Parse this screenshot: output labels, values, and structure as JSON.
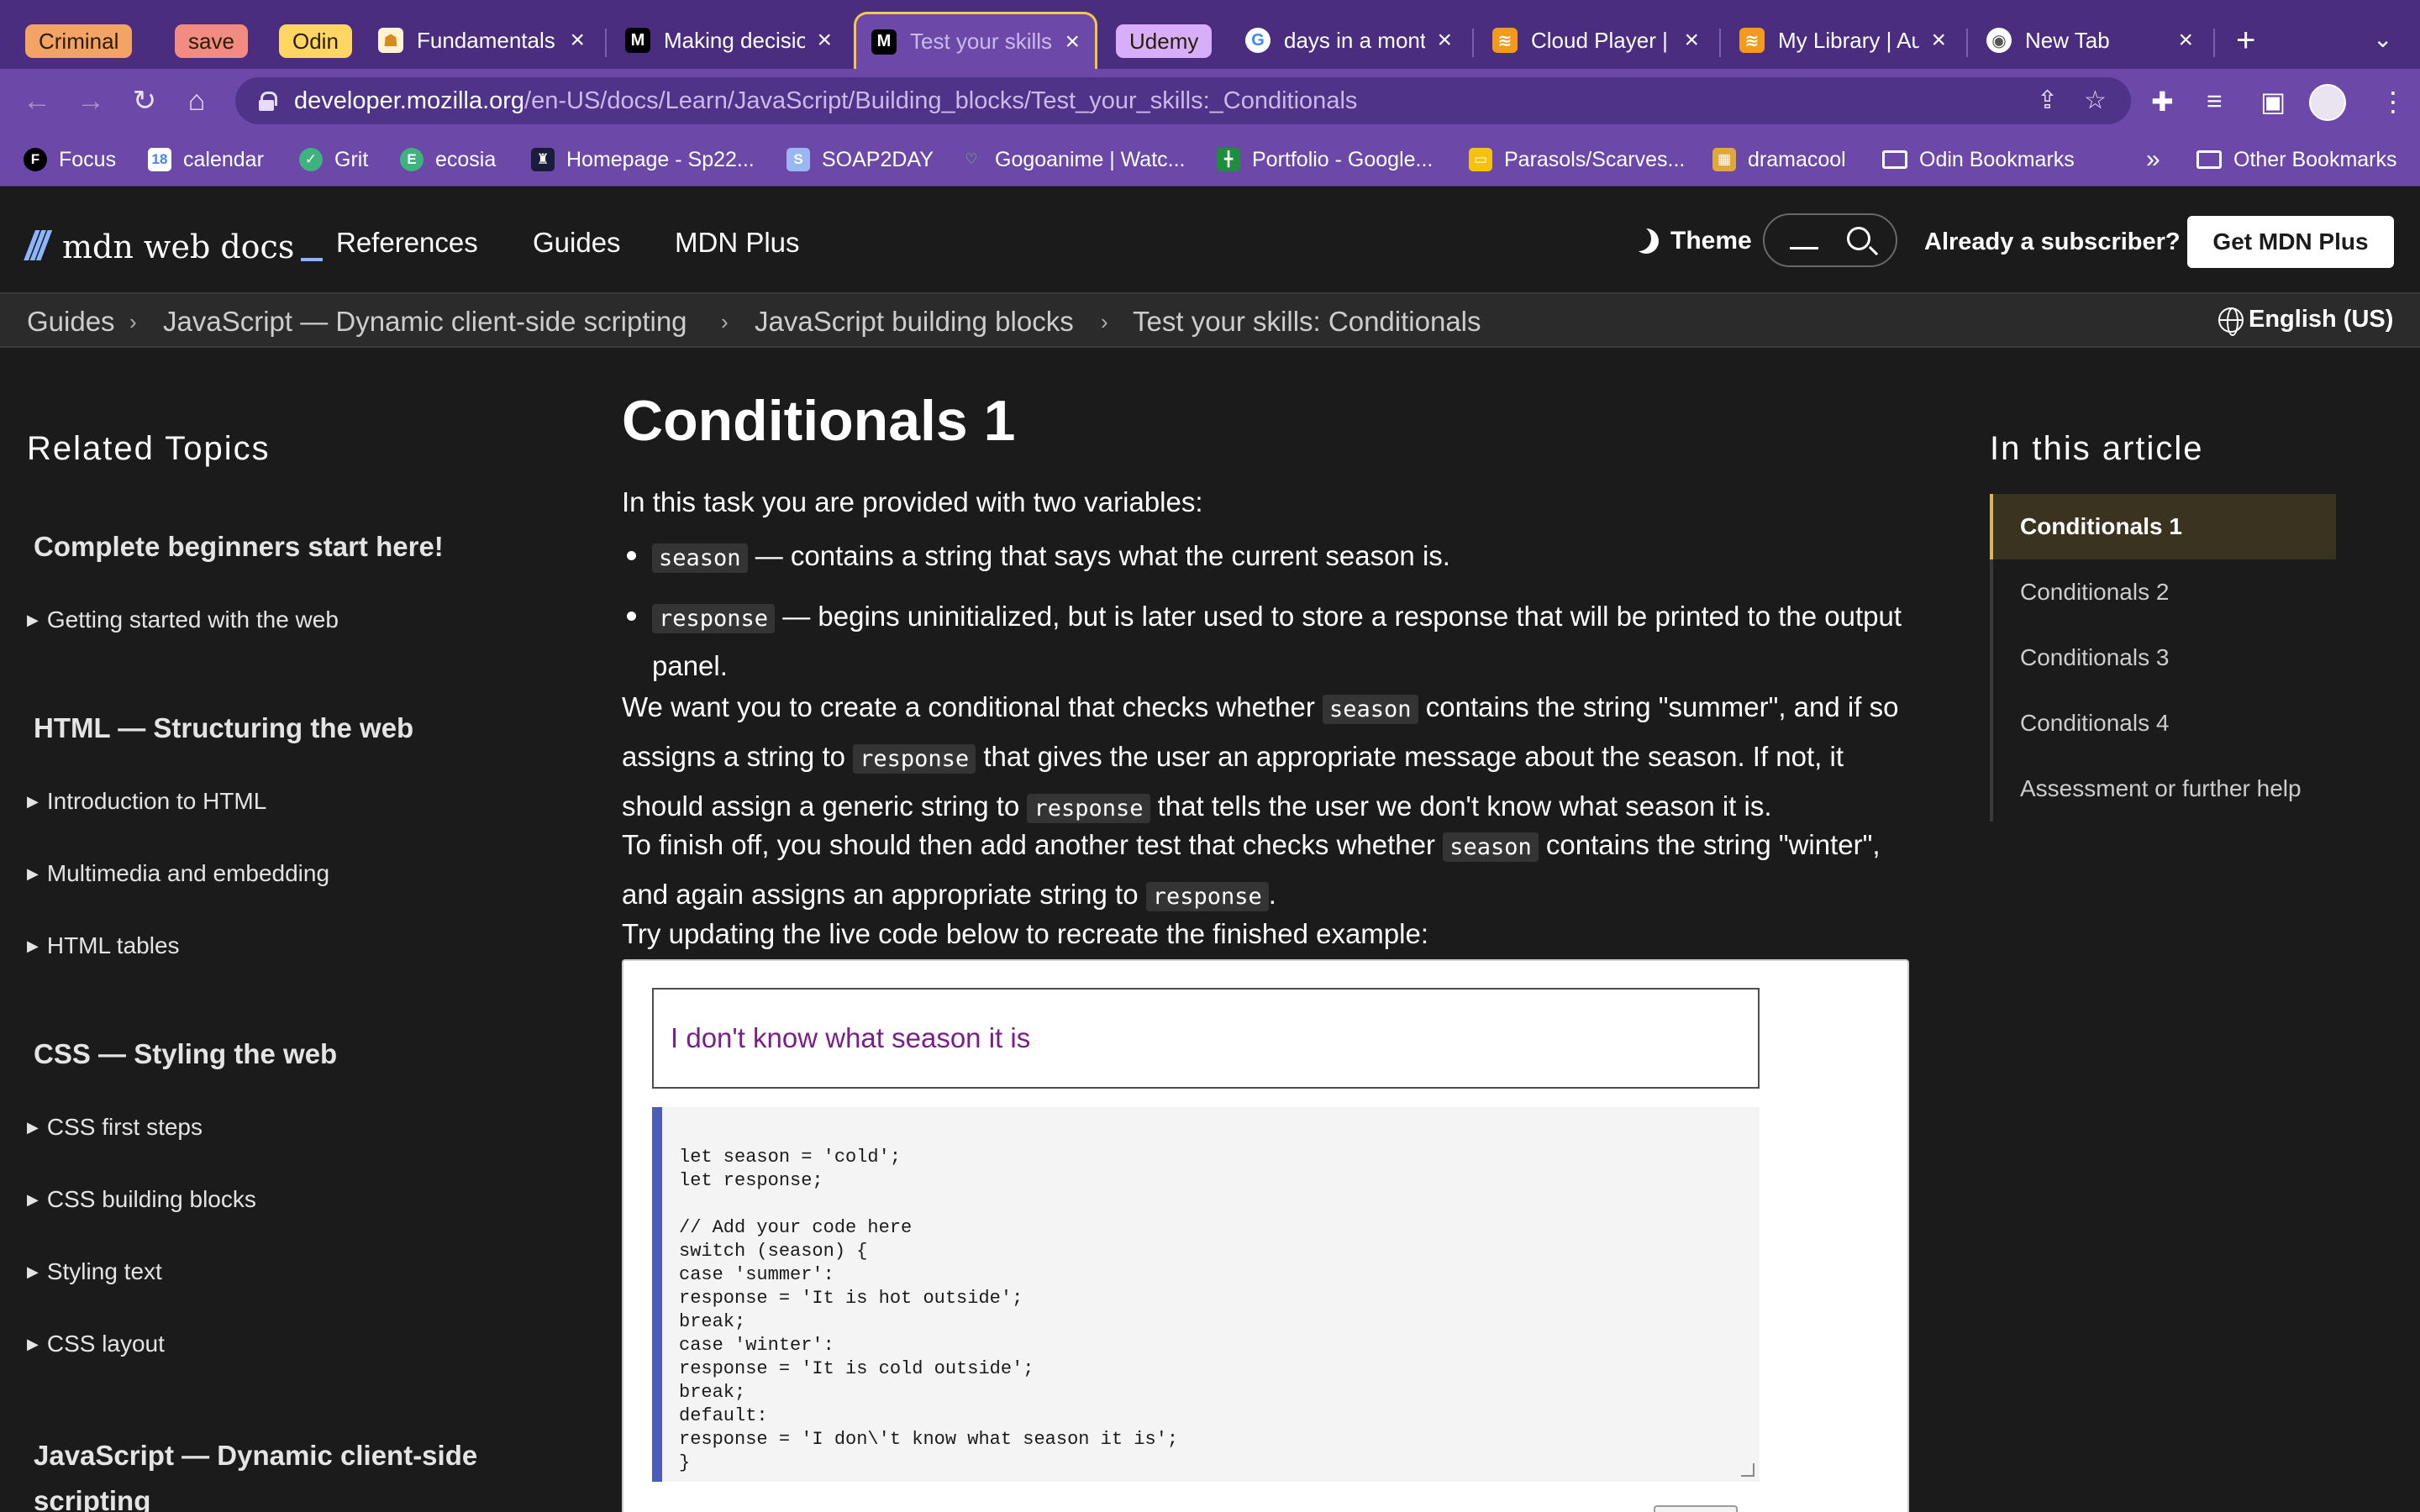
{
  "browser": {
    "tab_groups": [
      {
        "label": "Criminal",
        "color": "#f2a365"
      },
      {
        "label": "save",
        "color": "#f28b82"
      },
      {
        "label": "Odin",
        "color": "#fdd663"
      },
      {
        "label": "Udemy",
        "color": "#d7aefb"
      }
    ],
    "tabs": [
      {
        "title": "Fundamentals",
        "icon": "odin-icon"
      },
      {
        "title": "Making decisio",
        "icon": "mdn-icon"
      },
      {
        "title": "Test your skills",
        "icon": "mdn-icon",
        "active": true
      },
      {
        "title": "days in a mont",
        "icon": "google-icon"
      },
      {
        "title": "Cloud Player | A",
        "icon": "audible-icon"
      },
      {
        "title": "My Library | Au",
        "icon": "audible-icon"
      },
      {
        "title": "New Tab",
        "icon": "chrome-icon"
      }
    ],
    "url": {
      "host": "developer.mozilla.org",
      "path": "/en-US/docs/Learn/JavaScript/Building_blocks/Test_your_skills:_Conditionals"
    },
    "bookmarks": [
      "Focus",
      "calendar",
      "Grit",
      "ecosia",
      "Homepage - Sp22...",
      "SOAP2DAY",
      "Gogoanime | Watc...",
      "Portfolio - Google...",
      "Parasols/Scarves...",
      "dramacool",
      "Odin Bookmarks"
    ],
    "bookmarks_overflow": "»",
    "other_bookmarks": "Other Bookmarks"
  },
  "mdn": {
    "logo_text": "mdn web docs",
    "nav": [
      "References",
      "Guides",
      "MDN Plus"
    ],
    "theme_label": "Theme",
    "subscriber_label": "Already a subscriber?",
    "cta_label": "Get MDN Plus",
    "breadcrumbs": [
      "Guides",
      "JavaScript — Dynamic client-side scripting",
      "JavaScript building blocks",
      "Test your skills: Conditionals"
    ],
    "language": "English (US)"
  },
  "sidebar": {
    "title": "Related Topics",
    "sections": [
      {
        "heading": "Complete beginners start here!",
        "items": [
          "Getting started with the web"
        ]
      },
      {
        "heading": "HTML — Structuring the web",
        "items": [
          "Introduction to HTML",
          "Multimedia and embedding",
          "HTML tables"
        ]
      },
      {
        "heading": "CSS — Styling the web",
        "items": [
          "CSS first steps",
          "CSS building blocks",
          "Styling text",
          "CSS layout"
        ]
      },
      {
        "heading": "JavaScript — Dynamic client-side scripting",
        "items": []
      }
    ]
  },
  "article": {
    "title": "Conditionals 1",
    "intro": "In this task you are provided with two variables:",
    "bullet1": {
      "code": "season",
      "text": " — contains a string that says what the current season is."
    },
    "bullet2": {
      "code": "response",
      "text": " — begins uninitialized, but is later used to store a response that will be printed to the output panel."
    },
    "p2": {
      "a": "We want you to create a conditional that checks whether ",
      "code1": "season",
      "b": " contains the string \"summer\", and if so assigns a string to ",
      "code2": "response",
      "c": " that gives the user an appropriate message about the season. If not, it should assign a generic string to ",
      "code3": "response",
      "d": " that tells the user we don't know what season it is."
    },
    "p3": {
      "a": "To finish off, you should then add another test that checks whether ",
      "code1": "season",
      "b": " contains the string \"winter\", and again assigns an appropriate string to ",
      "code2": "response",
      "c": "."
    },
    "p4": "Try updating the live code below to recreate the finished example:",
    "output_text": "I don't know what season it is",
    "code": "let season = 'cold';\nlet response;\n\n// Add your code here\nswitch (season) {\ncase 'summer':\nresponse = 'It is hot outside';\nbreak;\ncase 'winter':\nresponse = 'It is cold outside';\nbreak;\ndefault:\nresponse = 'I don\\'t know what season it is';\n}"
  },
  "toc": {
    "title": "In this article",
    "items": [
      "Conditionals 1",
      "Conditionals 2",
      "Conditionals 3",
      "Conditionals 4",
      "Assessment or further help"
    ]
  }
}
